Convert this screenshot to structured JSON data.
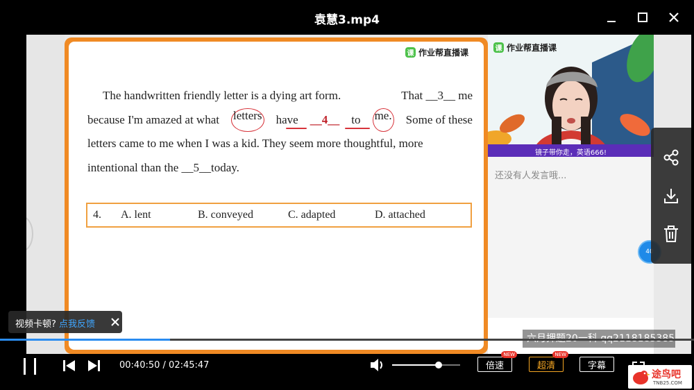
{
  "window": {
    "title": "袁慧3.mp4"
  },
  "slide": {
    "logo_text": "作业帮直播课",
    "logo_mark": "课",
    "passage": {
      "line1": [
        "The handwritten friendly letter is a dying art form.",
        "That __3__ me"
      ],
      "line2": {
        "part1": "because I'm amazed at what",
        "circled1": "letters",
        "part2": "have",
        "blank": "__4__",
        "part3": "to",
        "circled2": "me.",
        "part4": "Some of these"
      },
      "line3": "letters came to me when I was a kid. They seem more thoughtful, more",
      "line4": "intentional than the __5__today."
    },
    "question": {
      "number": "4.",
      "options": [
        "A. lent",
        "B. conveyed",
        "C. adapted",
        "D. attached"
      ]
    }
  },
  "live_panel": {
    "logo_text": "作业帮直播课",
    "logo_mark": "课",
    "banner": "镜子带你走，英语666!",
    "chat_empty": "还没有人发言哦...",
    "badge": "40"
  },
  "overlays": {
    "lag_tip": "视频卡顿?",
    "lag_link": "点我反馈",
    "watermark": "六月押题20一科 qq2118185385"
  },
  "playback": {
    "progress": 0.245,
    "current_time": "00:40:50",
    "separator": " / ",
    "total_time": "02:45:47",
    "volume": 0.68,
    "speed_label": "倍速",
    "quality_label": "超清",
    "subtitle_label": "字幕",
    "new_tag": "NEW"
  },
  "site_logo": {
    "text": "途鸟吧",
    "sub": "TNB25.COM"
  },
  "colors": {
    "slide_border": "#f08a24",
    "red_annotation": "#d7333a",
    "progress": "#2a8cf0",
    "active_pill": "#f5a623",
    "banner": "#5b2db8"
  }
}
